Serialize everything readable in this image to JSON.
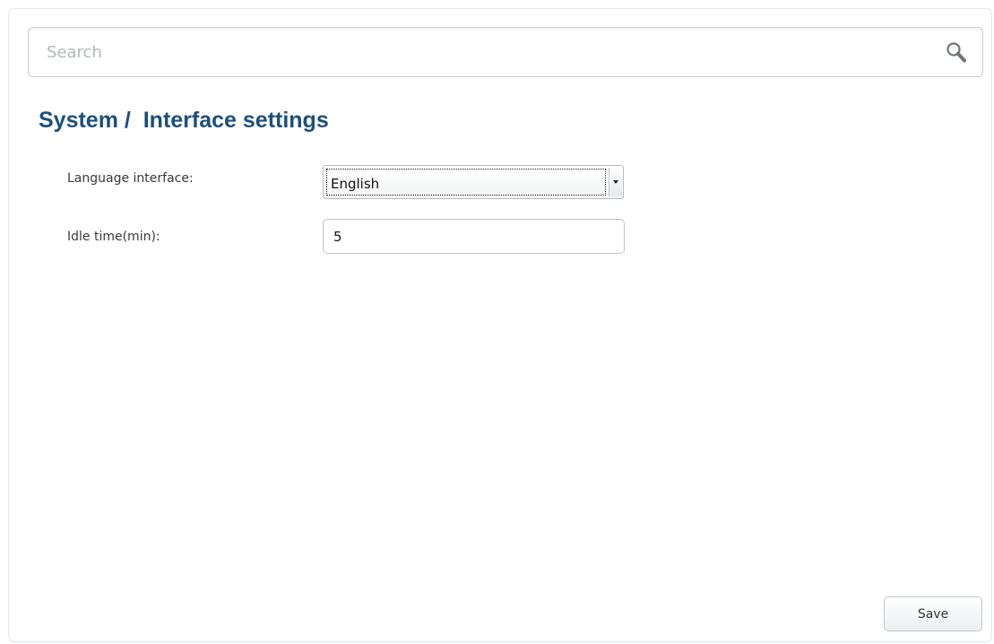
{
  "search": {
    "placeholder": "Search",
    "icon": "search-icon"
  },
  "page": {
    "title": "System /  Interface settings"
  },
  "form": {
    "language": {
      "label": "Language interface:",
      "value": "English"
    },
    "idle_time": {
      "label": "Idle time(min):",
      "value": "5"
    }
  },
  "actions": {
    "save_label": "Save"
  },
  "colors": {
    "title": "#1c4f7e",
    "border": "#c9ced4"
  }
}
